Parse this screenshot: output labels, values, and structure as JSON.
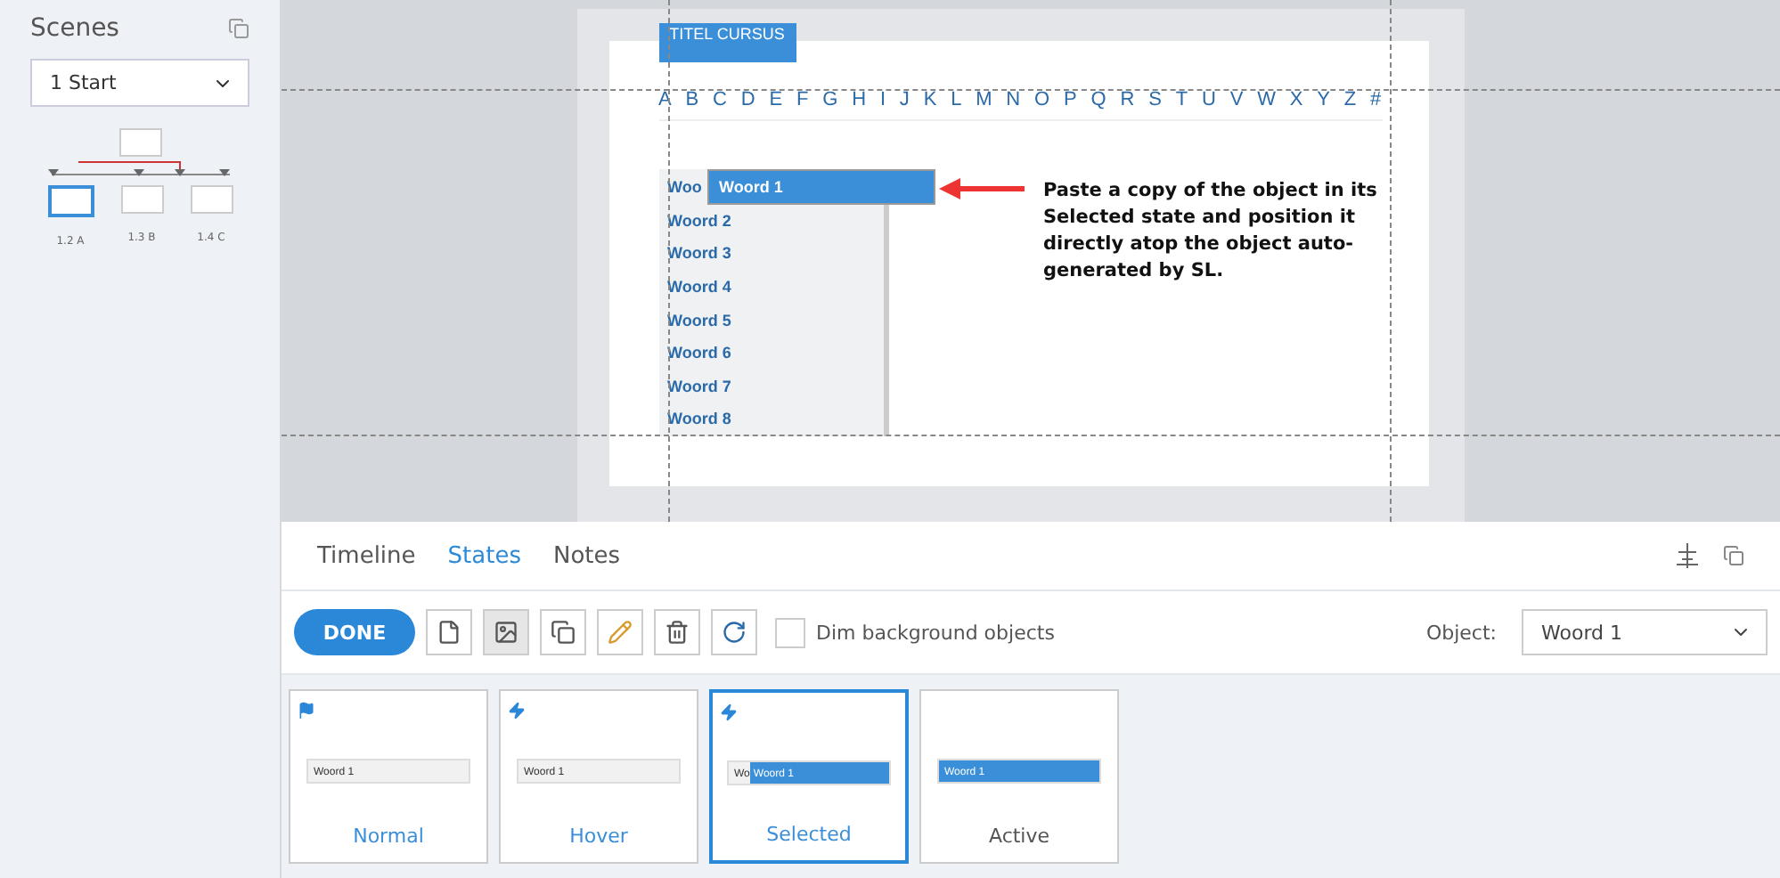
{
  "sidebar": {
    "title": "Scenes",
    "scene_select": "1 Start",
    "scenes": [
      {
        "label": "1.2 A",
        "selected": true
      },
      {
        "label": "1.3 B",
        "selected": false
      },
      {
        "label": "1.4 C",
        "selected": false
      }
    ]
  },
  "slide": {
    "title": "TITEL CURSUS",
    "letters": [
      "A",
      "B",
      "C",
      "D",
      "E",
      "F",
      "G",
      "H",
      "I",
      "J",
      "K",
      "L",
      "M",
      "N",
      "O",
      "P",
      "Q",
      "R",
      "S",
      "T",
      "U",
      "V",
      "W",
      "X",
      "Y",
      "Z",
      "#"
    ],
    "list": [
      "Woo",
      "Woord 2",
      "Woord 3",
      "Woord 4",
      "Woord 5",
      "Woord 6",
      "Woord 7",
      "Woord 8"
    ],
    "selected_object": "Woord 1",
    "callout": "Paste a copy of the object in its Selected state and position it directly atop the object auto-generated by SL."
  },
  "panel": {
    "tabs": [
      {
        "label": "Timeline",
        "selected": false
      },
      {
        "label": "States",
        "selected": true
      },
      {
        "label": "Notes",
        "selected": false
      }
    ],
    "done": "DONE",
    "tools": [
      {
        "kind": "new",
        "selected": false
      },
      {
        "kind": "image",
        "selected": true
      },
      {
        "kind": "copy",
        "selected": false
      },
      {
        "kind": "edit",
        "selected": false
      },
      {
        "kind": "delete",
        "selected": false
      },
      {
        "kind": "redo",
        "selected": false
      }
    ],
    "dim": {
      "label": "Dim background objects",
      "checked": false
    },
    "object_label": "Object:",
    "object_value": "Woord 1",
    "states": [
      {
        "label": "Normal",
        "kind": "normal",
        "preview_text": "Woord 1",
        "selected": false
      },
      {
        "label": "Hover",
        "kind": "hover",
        "preview_text": "Woord 1",
        "selected": false
      },
      {
        "label": "Selected",
        "kind": "selected",
        "preview_under": "Wo",
        "preview_text": "Woord 1",
        "selected": true
      },
      {
        "label": "Active",
        "kind": "active",
        "preview_text": "Woord 1",
        "selected": false
      }
    ]
  }
}
